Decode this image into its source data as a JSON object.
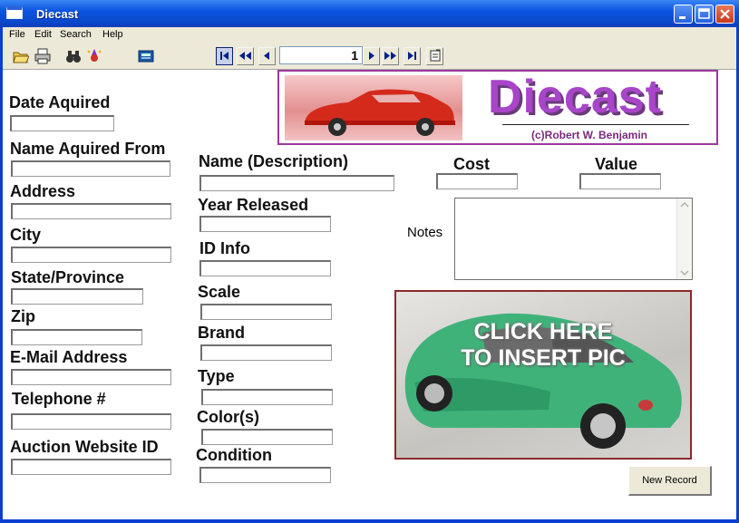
{
  "window": {
    "title": "Diecast"
  },
  "menu": [
    "File",
    "Edit",
    "Search",
    "Help"
  ],
  "toolbar": {
    "icons": [
      "open-folder-icon",
      "print-icon",
      "find-binoculars-icon",
      "wizard-icon",
      "calculator-icon"
    ]
  },
  "navigator": {
    "record_number": "1"
  },
  "banner": {
    "logo": "Diecast",
    "copyright": "(c)Robert W. Benjamin"
  },
  "left_fields": {
    "date_acquired": "Date Aquired",
    "name_acquired_from": "Name Aquired From",
    "address": "Address",
    "city": "City",
    "state_province": "State/Province",
    "zip": "Zip",
    "email": "E-Mail Address",
    "telephone": "Telephone #",
    "auction_id": "Auction Website ID"
  },
  "middle_fields": {
    "name_description": "Name (Description)",
    "year_released": "Year Released",
    "id_info": "ID Info",
    "scale": "Scale",
    "brand": "Brand",
    "type": "Type",
    "colors": "Color(s)",
    "condition": "Condition"
  },
  "right_fields": {
    "cost": "Cost",
    "value": "Value",
    "notes": "Notes"
  },
  "picture": {
    "line1": "CLICK HERE",
    "line2": "TO INSERT PIC"
  },
  "buttons": {
    "new_record": "New Record"
  },
  "colors": {
    "titlebar": "#0a55e0",
    "logo": "#a845c8",
    "frame": "#ece9d8"
  }
}
